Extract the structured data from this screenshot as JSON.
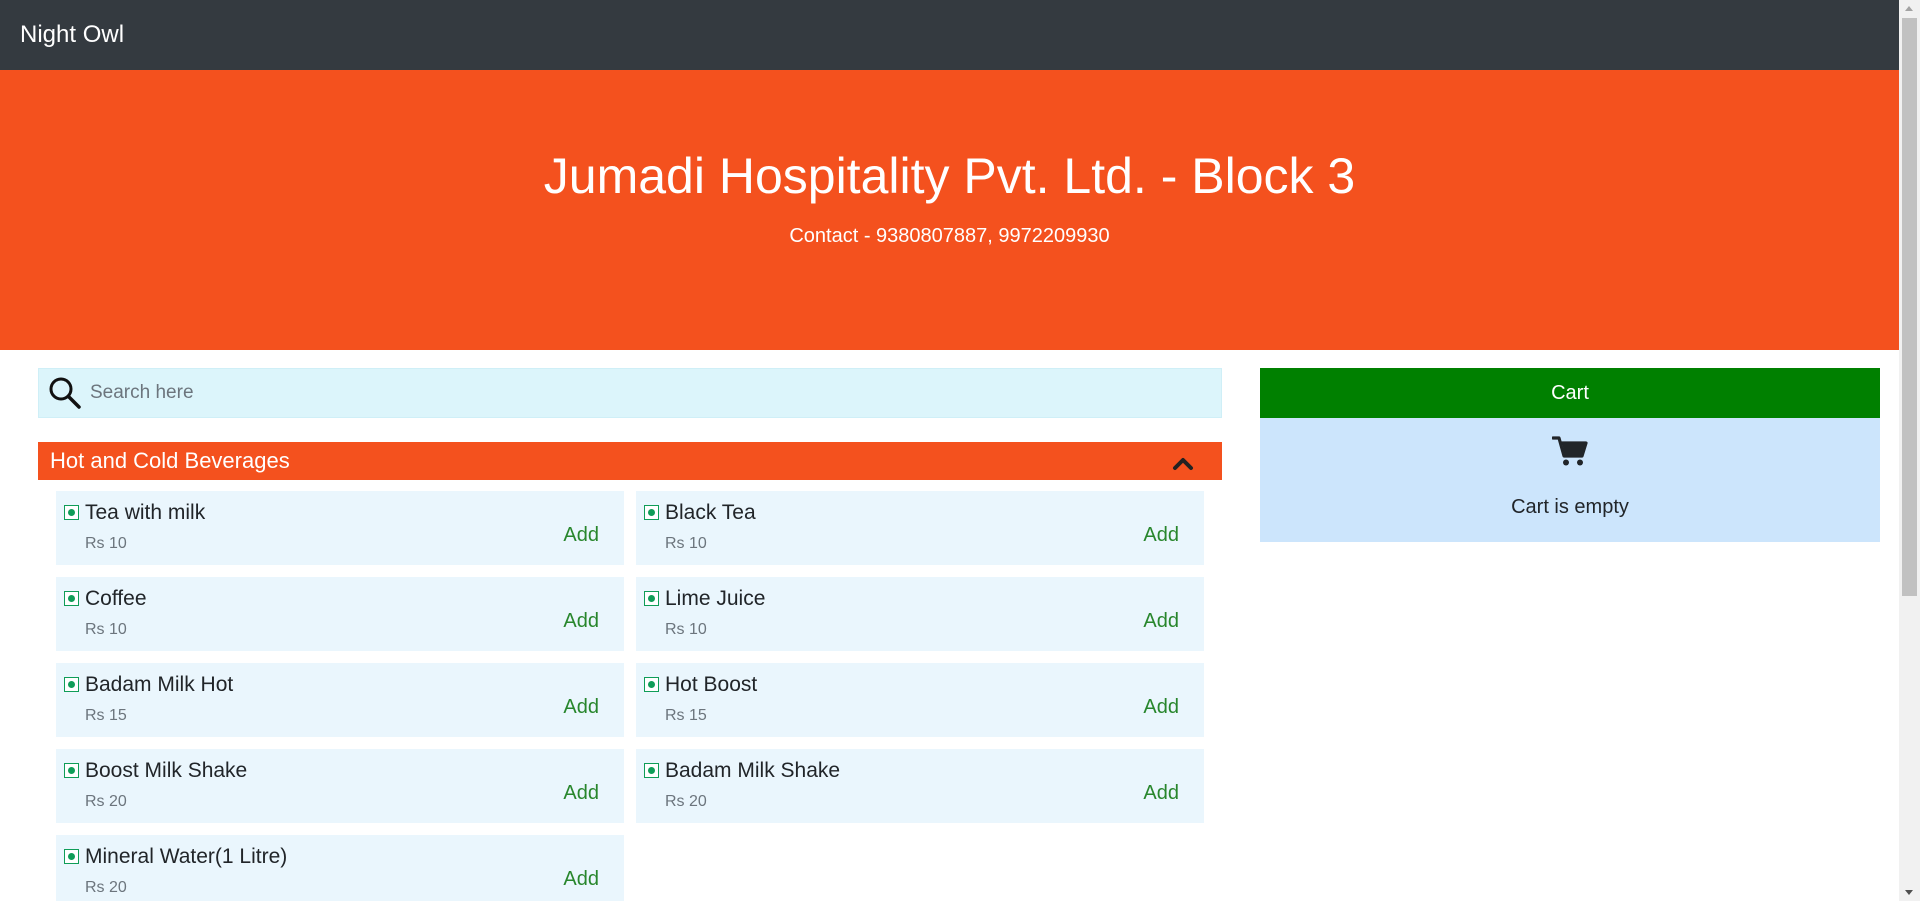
{
  "navbar": {
    "brand": "Night Owl"
  },
  "hero": {
    "title": "Jumadi Hospitality Pvt. Ltd. - Block 3",
    "contact": "Contact - 9380807887, 9972209930"
  },
  "search": {
    "placeholder": "Search here",
    "icon": "search-icon"
  },
  "category": {
    "title": "Hot and Cold Beverages",
    "expanded": true,
    "icon": "chevron-up-icon"
  },
  "items": [
    {
      "name": "Tea with milk",
      "price": "Rs 10",
      "add_label": "Add"
    },
    {
      "name": "Black Tea",
      "price": "Rs 10",
      "add_label": "Add"
    },
    {
      "name": "Coffee",
      "price": "Rs 10",
      "add_label": "Add"
    },
    {
      "name": "Lime Juice",
      "price": "Rs 10",
      "add_label": "Add"
    },
    {
      "name": "Badam Milk Hot",
      "price": "Rs 15",
      "add_label": "Add"
    },
    {
      "name": "Hot Boost",
      "price": "Rs 15",
      "add_label": "Add"
    },
    {
      "name": "Boost Milk Shake",
      "price": "Rs 20",
      "add_label": "Add"
    },
    {
      "name": "Badam Milk Shake",
      "price": "Rs 20",
      "add_label": "Add"
    },
    {
      "name": "Mineral Water(1 Litre)",
      "price": "Rs 20",
      "add_label": "Add"
    }
  ],
  "cart": {
    "title": "Cart",
    "empty_text": "Cart is empty",
    "icon": "cart-icon"
  },
  "colors": {
    "navbar": "#343a40",
    "brand_orange": "#f4511e",
    "cart_green": "#008000",
    "add_green": "#28862c",
    "item_bg": "#eaf6fd",
    "cart_bg": "#cce5fc",
    "search_bg": "#dcf5fb",
    "veg_green": "#0f9d58"
  }
}
